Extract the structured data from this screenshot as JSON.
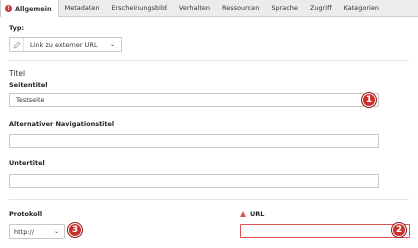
{
  "tabs": [
    {
      "label": "Allgemein",
      "active": true,
      "error": "!"
    },
    {
      "label": "Metadaten"
    },
    {
      "label": "Erscheinungsbild"
    },
    {
      "label": "Verhalten"
    },
    {
      "label": "Ressourcen"
    },
    {
      "label": "Sprache"
    },
    {
      "label": "Zugriff"
    },
    {
      "label": "Kategorien"
    }
  ],
  "typ": {
    "label": "Typ:",
    "value": "Link zu externer URL",
    "icon": "pencil-icon"
  },
  "titel_section": {
    "heading": "Titel",
    "seitentitel": {
      "label": "Seitentitel",
      "value": "Testseite"
    },
    "nav_titel": {
      "label": "Alternativer Navigationstitel",
      "value": ""
    },
    "untertitel": {
      "label": "Untertitel",
      "value": ""
    }
  },
  "protokoll": {
    "label": "Protokoll",
    "value": "http://"
  },
  "url": {
    "label": "URL",
    "value": ""
  },
  "markers": [
    "1",
    "2",
    "3"
  ],
  "colors": {
    "error": "#d9534f",
    "marker": "#c8322d",
    "tabbar": "#ececec"
  }
}
